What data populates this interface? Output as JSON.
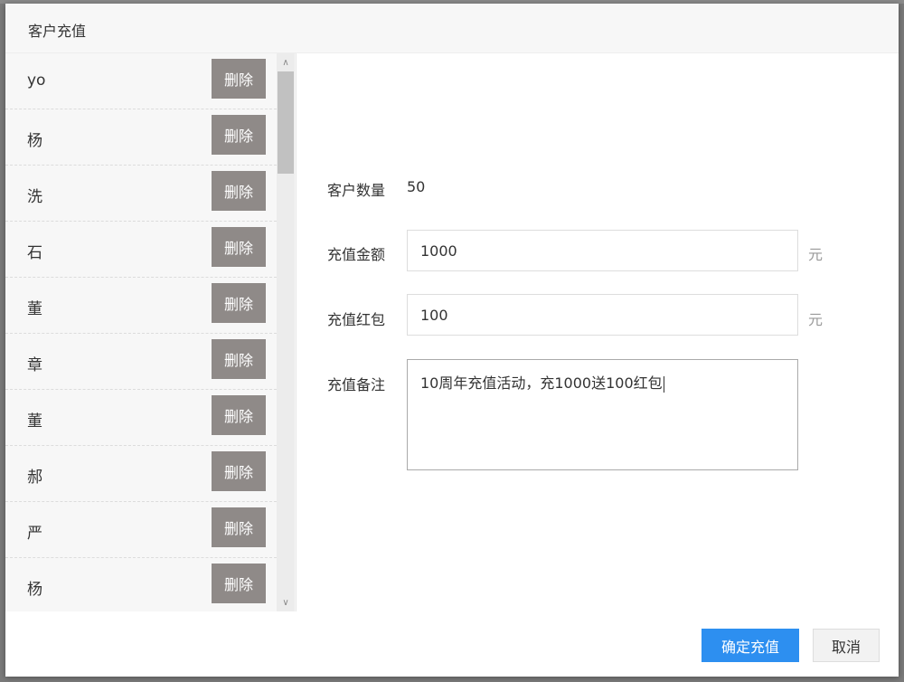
{
  "dialog": {
    "title": "客户充值"
  },
  "list": {
    "delete_label": "删除",
    "items": [
      {
        "name": "yo"
      },
      {
        "name": "杨"
      },
      {
        "name": "洗"
      },
      {
        "name": "石"
      },
      {
        "name": "董"
      },
      {
        "name": "章"
      },
      {
        "name": "董"
      },
      {
        "name": "郝"
      },
      {
        "name": "严"
      },
      {
        "name": "杨"
      }
    ]
  },
  "form": {
    "count_label": "客户数量",
    "count_value": "50",
    "amount_label": "充值金额",
    "amount_value": "1000",
    "amount_unit": "元",
    "bonus_label": "充值红包",
    "bonus_value": "100",
    "bonus_unit": "元",
    "note_label": "充值备注",
    "note_value": "10周年充值活动，充1000送100红包"
  },
  "footer": {
    "confirm_label": "确定充值",
    "cancel_label": "取消"
  },
  "colors": {
    "primary": "#2d8ff0",
    "delete_button": "#8f8a88"
  }
}
